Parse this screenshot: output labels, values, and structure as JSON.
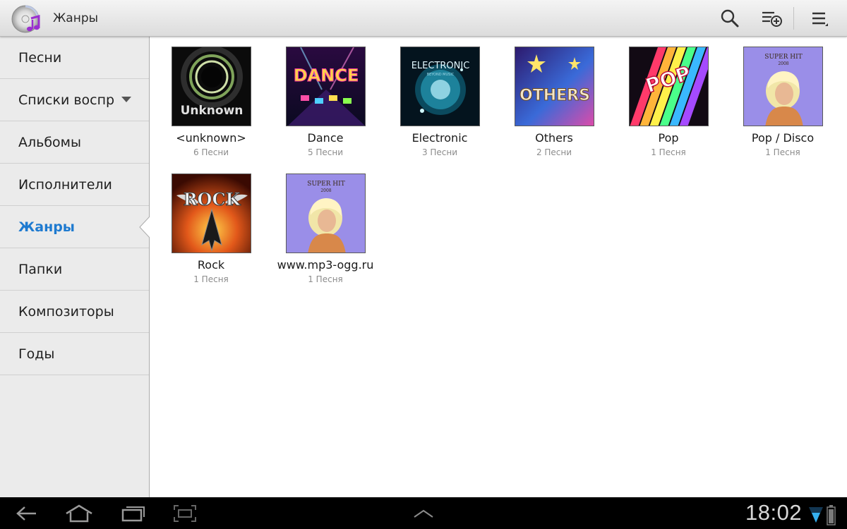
{
  "actionbar": {
    "title": "Жанры",
    "app_icon": "music-disc-icon",
    "actions": [
      "search-icon",
      "add-playlist-icon",
      "overflow-menu-icon"
    ]
  },
  "sidebar": {
    "items": [
      {
        "label": "Песни"
      },
      {
        "label": "Списки воспроизведения",
        "has_dropdown": true
      },
      {
        "label": "Альбомы"
      },
      {
        "label": "Исполнители"
      },
      {
        "label": "Жанры",
        "active": true
      },
      {
        "label": "Папки"
      },
      {
        "label": "Композиторы"
      },
      {
        "label": "Годы"
      }
    ],
    "active_color": "#1e7ad0"
  },
  "genres": [
    {
      "name": "<unknown>",
      "count": "6 Песни",
      "cover_text": "Unknown"
    },
    {
      "name": "Dance",
      "count": "5 Песни",
      "cover_text": "DANCE"
    },
    {
      "name": "Electronic",
      "count": "3 Песни",
      "cover_text": "ELECTRONIC",
      "cover_subtext": "BEYOND MUSIC"
    },
    {
      "name": "Others",
      "count": "2 Песни",
      "cover_text": "OTHERS"
    },
    {
      "name": "Pop",
      "count": "1 Песня",
      "cover_text": "POP"
    },
    {
      "name": "Pop / Disco",
      "count": "1 Песня",
      "cover_text": "SUPER HIT",
      "cover_subtext": "2008"
    },
    {
      "name": "Rock",
      "count": "1 Песня",
      "cover_text": "ROCK"
    },
    {
      "name": "www.mp3-ogg.ru",
      "count": "1 Песня",
      "cover_text": "SUPER HIT",
      "cover_subtext": "2008"
    }
  ],
  "system_bar": {
    "clock": "18:02",
    "buttons": [
      "back-icon",
      "home-icon",
      "recent-apps-icon",
      "screenshot-icon",
      "chevron-up-icon"
    ],
    "status": [
      "wifi-icon",
      "battery-icon"
    ]
  }
}
